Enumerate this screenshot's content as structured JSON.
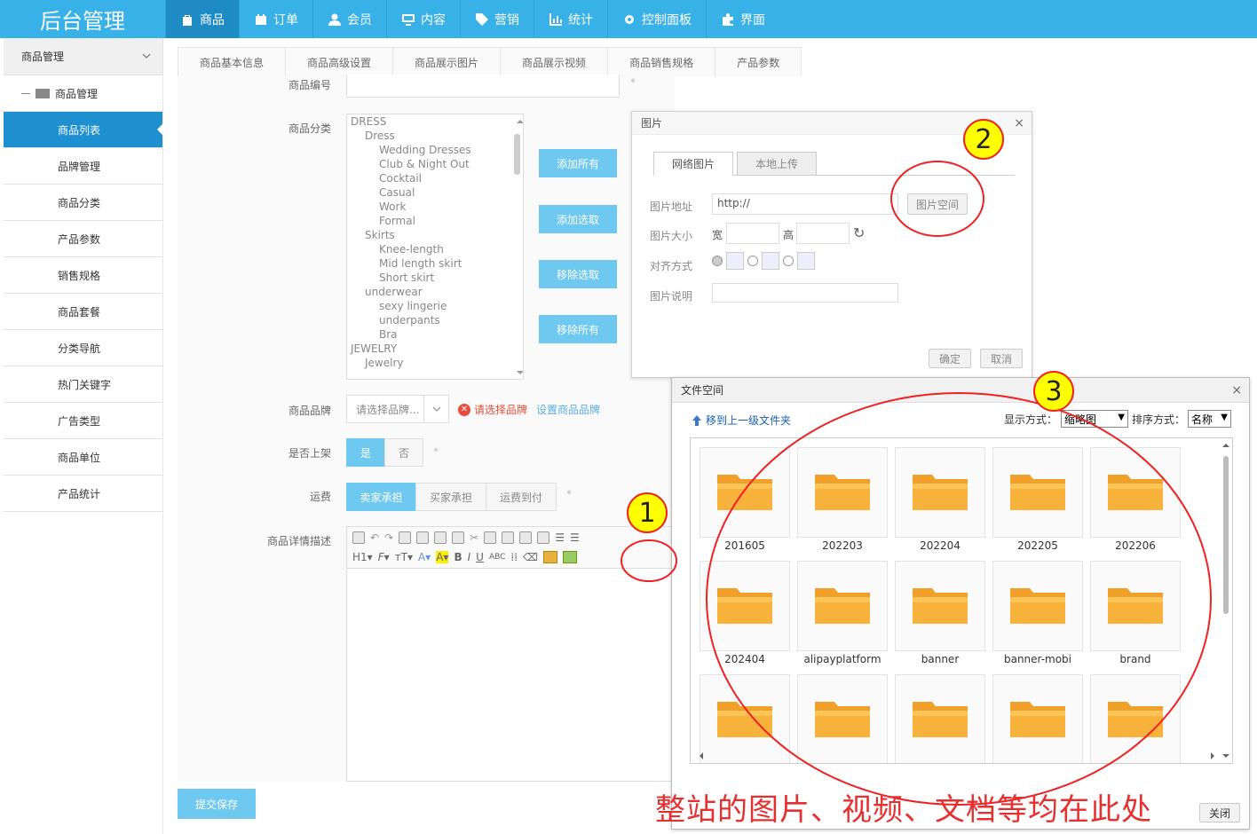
{
  "app": {
    "title": "后台管理"
  },
  "nav": [
    {
      "label": "商品",
      "icon": "bag-icon"
    },
    {
      "label": "订单",
      "icon": "order-icon"
    },
    {
      "label": "会员",
      "icon": "user-icon"
    },
    {
      "label": "内容",
      "icon": "monitor-icon"
    },
    {
      "label": "营销",
      "icon": "tag-icon"
    },
    {
      "label": "统计",
      "icon": "chart-icon"
    },
    {
      "label": "控制面板",
      "icon": "gear-icon"
    },
    {
      "label": "界面",
      "icon": "puzzle-icon"
    }
  ],
  "sidebar": {
    "group": "商品管理",
    "sub": "商品管理",
    "items": [
      "商品列表",
      "品牌管理",
      "商品分类",
      "产品参数",
      "销售规格",
      "商品套餐",
      "分类导航",
      "热门关键字",
      "广告类型",
      "商品单位",
      "产品统计"
    ]
  },
  "tabs": [
    "商品基本信息",
    "商品高级设置",
    "商品展示图片",
    "商品展示视频",
    "商品销售规格",
    "产品参数"
  ],
  "form": {
    "code_label": "商品编号",
    "category_label": "商品分类",
    "categories": [
      {
        "text": "DRESS",
        "level": 0
      },
      {
        "text": "Dress",
        "level": 1
      },
      {
        "text": "Wedding Dresses",
        "level": 2
      },
      {
        "text": "Club & Night Out",
        "level": 2
      },
      {
        "text": "Cocktail",
        "level": 2
      },
      {
        "text": "Casual",
        "level": 2
      },
      {
        "text": "Work",
        "level": 2
      },
      {
        "text": "Formal",
        "level": 2
      },
      {
        "text": "Skirts",
        "level": 1
      },
      {
        "text": "Knee-length",
        "level": 2
      },
      {
        "text": "Mid length skirt",
        "level": 2
      },
      {
        "text": "Short skirt",
        "level": 2
      },
      {
        "text": "underwear",
        "level": 1
      },
      {
        "text": "sexy lingerie",
        "level": 2
      },
      {
        "text": "underpants",
        "level": 2
      },
      {
        "text": "Bra",
        "level": 2
      },
      {
        "text": "JEWELRY",
        "level": 0
      },
      {
        "text": "Jewelry",
        "level": 1
      }
    ],
    "cat_buttons": [
      "添加所有",
      "添加选取",
      "移除选取",
      "移除所有"
    ],
    "brand_label": "商品品牌",
    "brand_placeholder": "请选择品牌...",
    "brand_error": "请选择品牌",
    "brand_link": "设置商品品牌",
    "onsale_label": "是否上架",
    "onsale_options": [
      "是",
      "否"
    ],
    "freight_label": "运费",
    "freight_options": [
      "卖家承担",
      "买家承担",
      "运费到付"
    ],
    "desc_label": "商品详情描述",
    "submit": "提交保存",
    "required_mark": "*"
  },
  "image_dialog": {
    "title": "图片",
    "tabs": [
      "网络图片",
      "本地上传"
    ],
    "url_label": "图片地址",
    "url_value": "http://",
    "space_button": "图片空间",
    "size_label": "图片大小",
    "width_label": "宽",
    "height_label": "高",
    "align_label": "对齐方式",
    "desc_label": "图片说明",
    "ok": "确定",
    "cancel": "取消",
    "close": "×"
  },
  "file_dialog": {
    "title": "文件空间",
    "up_link": "移到上一级文件夹",
    "view_label": "显示方式：",
    "view_value": "缩略图",
    "sort_label": "排序方式：",
    "sort_value": "名称",
    "folders": [
      "201605",
      "202203",
      "202204",
      "202205",
      "202206",
      "202404",
      "alipayplatform",
      "banner",
      "banner-mobi",
      "brand",
      "",
      "",
      "",
      "",
      ""
    ],
    "close_button": "关闭",
    "close": "×"
  },
  "annotations": {
    "num1": "1",
    "num2": "2",
    "num3": "3",
    "caption": "整站的图片、视频、文档等均在此处",
    "color": "#e53030"
  }
}
